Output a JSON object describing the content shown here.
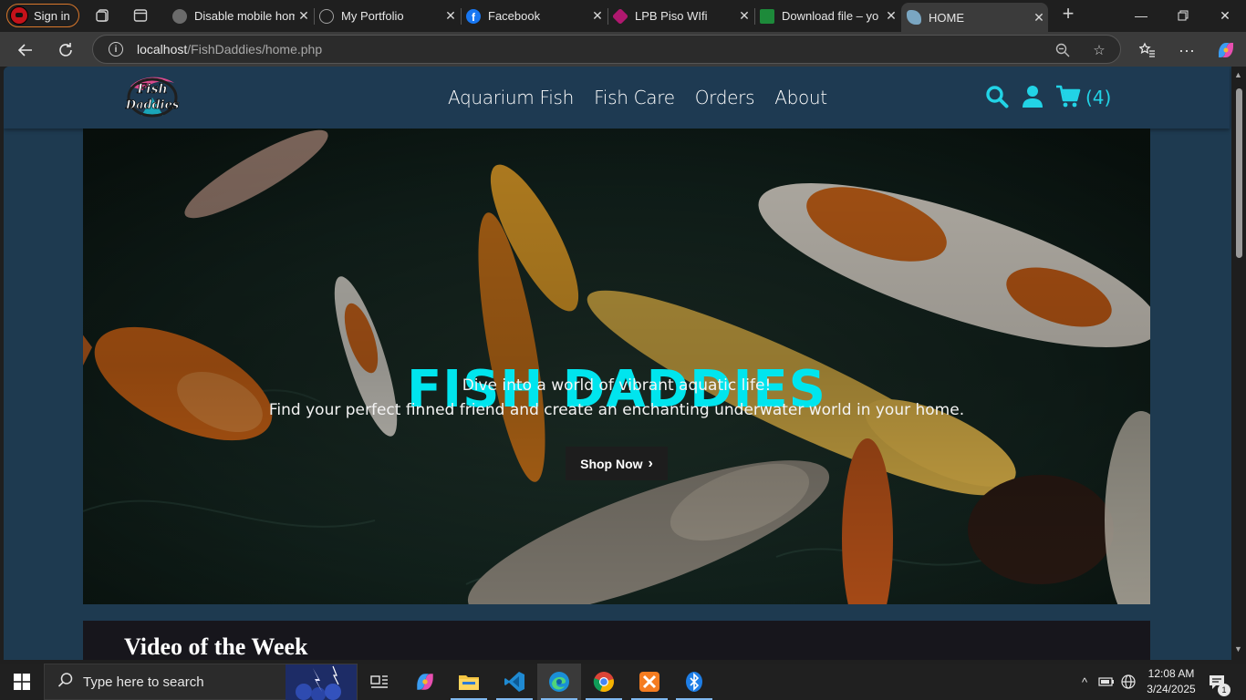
{
  "browser": {
    "signin_label": "Sign in",
    "tabs": [
      {
        "title": "Disable mobile home",
        "favicon": "settings-favicon",
        "color": "#6b6b6b"
      },
      {
        "title": "My Portfolio",
        "favicon": "globe-favicon",
        "color": "#5a5a5a"
      },
      {
        "title": "Facebook",
        "favicon": "facebook-favicon",
        "color": "#1877f2"
      },
      {
        "title": "LPB Piso WIfi",
        "favicon": "wifi-favicon",
        "color": "#b0186f"
      },
      {
        "title": "Download file – yo",
        "favicon": "download-favicon",
        "color": "#1d8a3a"
      },
      {
        "title": "HOME",
        "favicon": "fish-favicon",
        "color": "#7aa6c2"
      }
    ],
    "address": {
      "host": "localhost",
      "path": "/FishDaddies/home.php"
    }
  },
  "site": {
    "logo_alt": "Fish Daddies",
    "nav": [
      "Aquarium Fish",
      "Fish Care",
      "Orders",
      "About"
    ],
    "cart_count": "(4)",
    "accent": "#22d3e6",
    "hero": {
      "title": "FISH DADDIES",
      "line1": "Dive into a world of vibrant aquatic life!",
      "line2": "Find your perfect finned friend and create an enchanting underwater world in your home.",
      "button": "Shop Now"
    },
    "video_heading": "Video of the Week"
  },
  "taskbar": {
    "search_placeholder": "Type here to search",
    "time": "12:08 AM",
    "date": "3/24/2025",
    "notifications": "1"
  }
}
